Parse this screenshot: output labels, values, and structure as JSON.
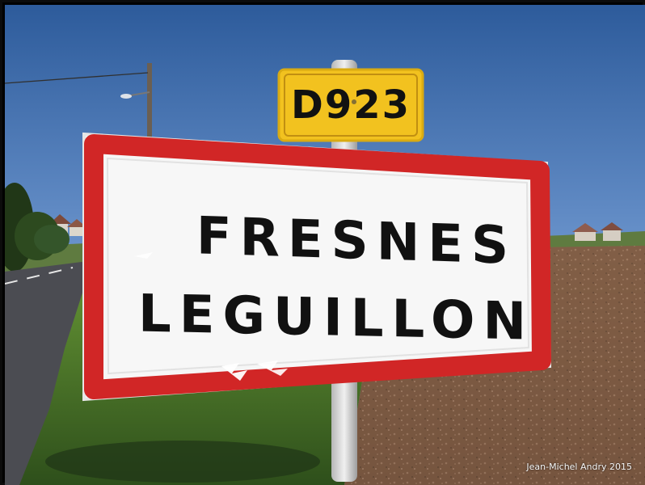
{
  "route_plate": {
    "text": "D923"
  },
  "town_sign": {
    "line1": "FRESNES",
    "line2": "LEGUILLON"
  },
  "credit": {
    "text": "Jean-Michel Andry 2015"
  },
  "colors": {
    "sky_top": "#2f5fa0",
    "sky_bottom": "#9fc3ea",
    "grass": "#5e8f2e",
    "field": "#7b5b43",
    "road": "#4e4f55",
    "sign_border": "#d12626",
    "sign_background": "#f6f6f6",
    "route_plate": "#f1bf1e"
  }
}
